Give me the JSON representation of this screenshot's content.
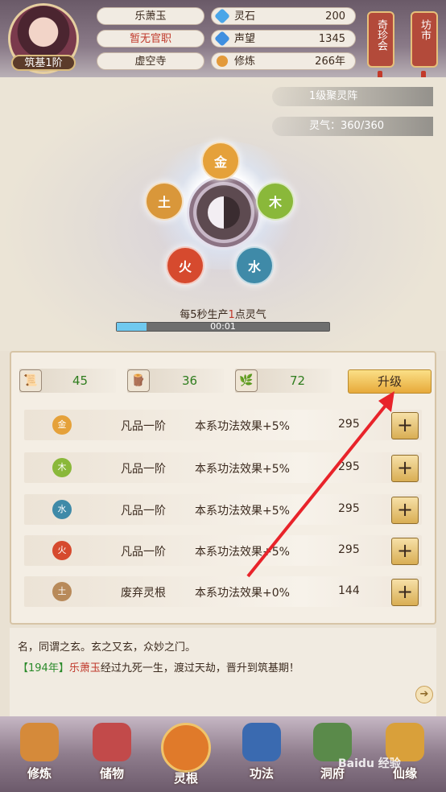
{
  "header": {
    "player_name": "乐萧玉",
    "title": "暂无官职",
    "sect": "虚空寺",
    "rank": "筑基1阶",
    "stats": [
      {
        "icon": "spirit-stone-icon",
        "label": "灵石",
        "value": "200",
        "color": "#4aa6e8"
      },
      {
        "icon": "reputation-icon",
        "label": "声望",
        "value": "1345",
        "color": "#3f8fe0"
      },
      {
        "icon": "cultivation-icon",
        "label": "修炼",
        "value": "266年",
        "color": "#e39a3a"
      }
    ],
    "side_tabs": [
      {
        "label": "奇珍会"
      },
      {
        "label": "坊市"
      }
    ]
  },
  "formation": {
    "name": "1级聚灵阵",
    "spirit_qi_label": "灵气：",
    "spirit_qi_value": "360/360",
    "production_prefix": "每5秒生产",
    "production_amount": "1",
    "production_suffix": "点灵气",
    "progress_fraction": 0.14,
    "timer": "00:01",
    "elements": [
      {
        "label": "金",
        "color": "#e5a13a"
      },
      {
        "label": "木",
        "color": "#8ab83a"
      },
      {
        "label": "水",
        "color": "#3f8aa8"
      },
      {
        "label": "火",
        "color": "#d64a2e"
      },
      {
        "label": "土",
        "color": "#d9973a"
      }
    ]
  },
  "resources": [
    {
      "icon": "scroll-icon",
      "value": "45"
    },
    {
      "icon": "wood-icon",
      "value": "36"
    },
    {
      "icon": "herb-icon",
      "value": "72"
    }
  ],
  "upgrade_label": "升级",
  "roots": [
    {
      "element": "金",
      "color": "#e5a13a",
      "grade": "凡品一阶",
      "effect": "本系功法效果+5%",
      "value": "295"
    },
    {
      "element": "木",
      "color": "#8ab83a",
      "grade": "凡品一阶",
      "effect": "本系功法效果+5%",
      "value": "295"
    },
    {
      "element": "水",
      "color": "#3f8aa8",
      "grade": "凡品一阶",
      "effect": "本系功法效果+5%",
      "value": "295"
    },
    {
      "element": "火",
      "color": "#d64a2e",
      "grade": "凡品一阶",
      "effect": "本系功法效果+5%",
      "value": "295"
    },
    {
      "element": "土",
      "color": "#b88a5a",
      "grade": "废弃灵根",
      "effect": "本系功法效果+0%",
      "value": "144"
    }
  ],
  "log": {
    "line1": "名，同谓之玄。玄之又玄，众妙之门。",
    "year": "【194年】",
    "name": "乐萧玉",
    "event": "经过九死一生，渡过天劫，晋升到筑基期！"
  },
  "nav": [
    {
      "label": "修炼",
      "icon": "monk-icon",
      "color": "#d58a3a"
    },
    {
      "label": "储物",
      "icon": "bag-icon",
      "color": "#c24a4a"
    },
    {
      "label": "灵根",
      "icon": "spirit-root-icon",
      "color": "#e07a2a"
    },
    {
      "label": "功法",
      "icon": "book-icon",
      "color": "#3a6ab0"
    },
    {
      "label": "洞府",
      "icon": "cave-house-icon",
      "color": "#5a8a4a"
    },
    {
      "label": "仙缘",
      "icon": "gourd-icon",
      "color": "#d9a03a"
    }
  ],
  "watermark": "Baidu 经验"
}
